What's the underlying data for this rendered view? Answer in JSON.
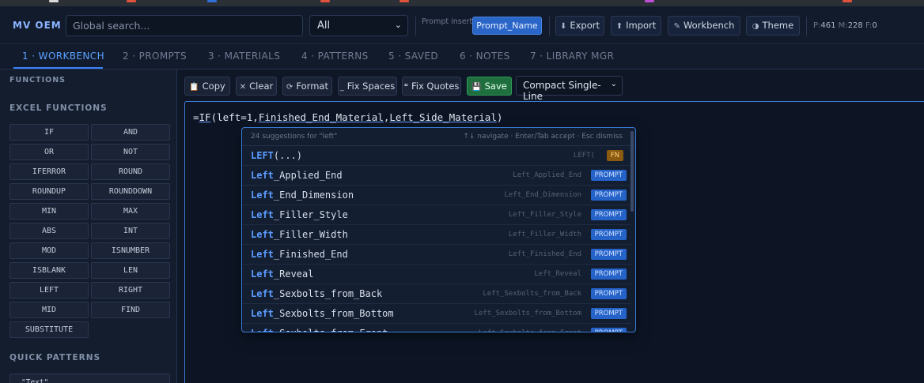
{
  "app": {
    "brand": "MV OEM"
  },
  "browser_strip": {
    "colors": [
      "#d9d9d9",
      "#e0523c",
      "#2f6fd6",
      "#e0523c",
      "#e0523c",
      "#c04fd8",
      "#e0523c"
    ]
  },
  "header": {
    "search_placeholder": "Global search...",
    "scope_value": "All",
    "prompt_insert_label": "Prompt insert",
    "prompt_chip": "Prompt_Name",
    "buttons": [
      {
        "icon": "⬇",
        "label": "Export"
      },
      {
        "icon": "⬆",
        "label": "Import"
      },
      {
        "icon": "✎",
        "label": "Workbench"
      },
      {
        "icon": "◑",
        "label": "Theme"
      }
    ],
    "counts": {
      "p_label": "P:",
      "p": "461",
      "m_label": " M:",
      "m": "228",
      "f_label": " F:",
      "f": "0"
    }
  },
  "tabs": [
    {
      "label": "1 · WORKBENCH"
    },
    {
      "label": "2 · PROMPTS"
    },
    {
      "label": "3 · MATERIALS"
    },
    {
      "label": "4 · PATTERNS"
    },
    {
      "label": "5 · SAVED"
    },
    {
      "label": "6 · NOTES"
    },
    {
      "label": "7 · LIBRARY MGR"
    }
  ],
  "sidebar": {
    "functions_heading": "FUNCTIONS",
    "excel_heading": "EXCEL FUNCTIONS",
    "functions": [
      "IF",
      "AND",
      "OR",
      "NOT",
      "IFERROR",
      "ROUND",
      "ROUNDUP",
      "ROUNDDOWN",
      "MIN",
      "MAX",
      "ABS",
      "INT",
      "MOD",
      "ISNUMBER",
      "ISBLANK",
      "LEN",
      "LEFT",
      "RIGHT",
      "MID",
      "FIND",
      "SUBSTITUTE"
    ],
    "patterns_heading": "QUICK PATTERNS",
    "pattern_first": "\"Text\""
  },
  "editor_toolbar": {
    "copy": {
      "icon": "📋",
      "label": "Copy"
    },
    "clear": {
      "icon": "✕",
      "label": "Clear"
    },
    "format": {
      "icon": "⟳",
      "label": "Format"
    },
    "fix_spaces": {
      "icon": "_",
      "label": "Fix Spaces"
    },
    "fix_quotes": {
      "icon": "❝",
      "label": "Fix Quotes"
    },
    "save": {
      "icon": "💾",
      "label": "Save"
    },
    "mode": "Compact Single-Line"
  },
  "editor": {
    "formula_prefix": "=",
    "formula_fn": "IF",
    "formula_open": "(left=1,",
    "formula_arg1": "Finished_End_Material",
    "formula_comma": ",",
    "formula_arg2": "Left_Side_Material",
    "formula_close": ")"
  },
  "autocomplete": {
    "count_text": "24 suggestions for \"left\"",
    "hint_text": "↑↓ navigate · Enter/Tab accept · Esc dismiss",
    "items": [
      {
        "match": "LEFT",
        "rest": "(...)",
        "ghost": "LEFT(",
        "badge": "FN"
      },
      {
        "match": "Left",
        "rest": "_Applied_End",
        "ghost": "Left_Applied_End",
        "badge": "PROMPT"
      },
      {
        "match": "Left",
        "rest": "_End_Dimension",
        "ghost": "Left_End_Dimension",
        "badge": "PROMPT"
      },
      {
        "match": "Left",
        "rest": "_Filler_Style",
        "ghost": "Left_Filler_Style",
        "badge": "PROMPT"
      },
      {
        "match": "Left",
        "rest": "_Filler_Width",
        "ghost": "Left_Filler_Width",
        "badge": "PROMPT"
      },
      {
        "match": "Left",
        "rest": "_Finished_End",
        "ghost": "Left_Finished_End",
        "badge": "PROMPT"
      },
      {
        "match": "Left",
        "rest": "_Reveal",
        "ghost": "Left_Reveal",
        "badge": "PROMPT"
      },
      {
        "match": "Left",
        "rest": "_Sexbolts_from_Back",
        "ghost": "Left_Sexbolts_from_Back",
        "badge": "PROMPT"
      },
      {
        "match": "Left",
        "rest": "_Sexbolts_from_Bottom",
        "ghost": "Left_Sexbolts_from_Bottom",
        "badge": "PROMPT"
      },
      {
        "match": "Left",
        "rest": "_Sexbolts_from_Front",
        "ghost": "Left_Sexbolts_from_Front",
        "badge": "PROMPT"
      }
    ]
  }
}
